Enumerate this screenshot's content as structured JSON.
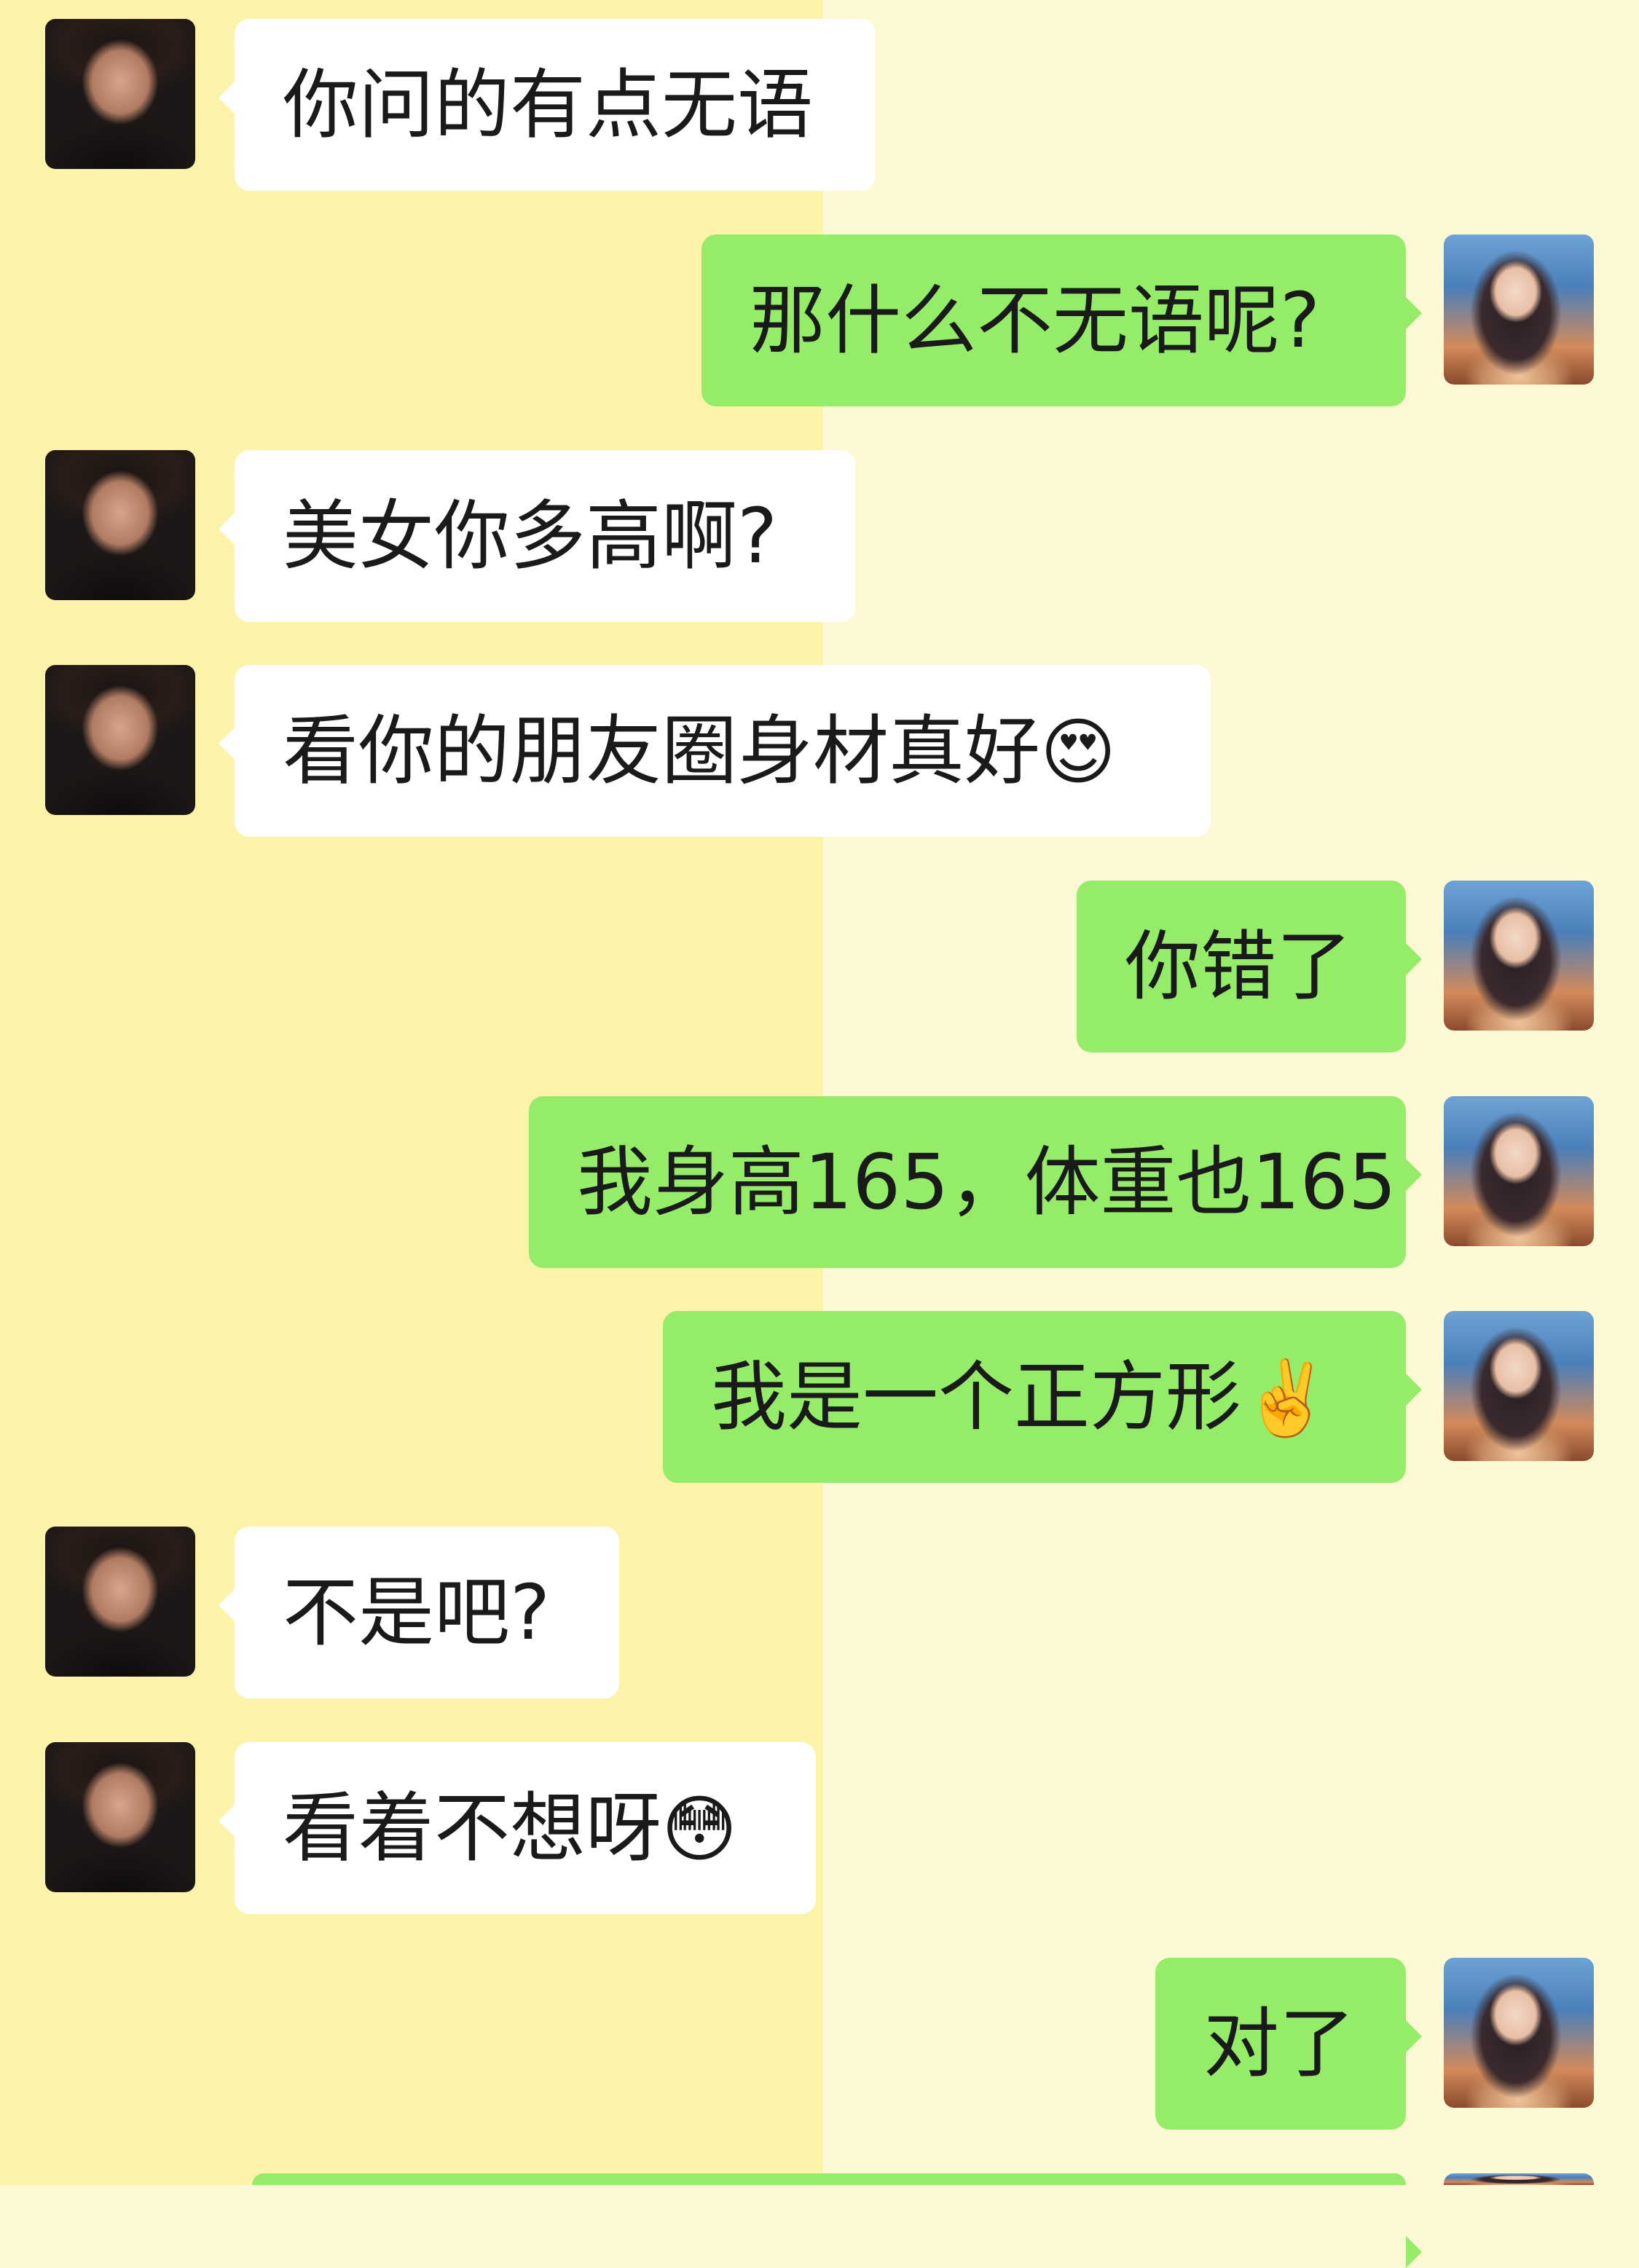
{
  "chat": {
    "messages": [
      {
        "sender": "other",
        "text": "你问的有点无语"
      },
      {
        "sender": "me",
        "text": "那什么不无语呢?"
      },
      {
        "sender": "other",
        "text": "美女你多高啊?"
      },
      {
        "sender": "other",
        "text": "看你的朋友圈身材真好",
        "emoji": "😍"
      },
      {
        "sender": "me",
        "text": "你错了"
      },
      {
        "sender": "me",
        "text": "我身高165，体重也165"
      },
      {
        "sender": "me",
        "text": "我是一个正方形",
        "emoji": "✌️"
      },
      {
        "sender": "other",
        "text": "不是吧?"
      },
      {
        "sender": "other",
        "text": "看着不想呀",
        "emoji": "😳"
      },
      {
        "sender": "me",
        "text": "对了"
      }
    ]
  },
  "colors": {
    "left_background": "#fbf3a8",
    "right_background": "#fdf9d4",
    "incoming_bubble": "#ffffff",
    "outgoing_bubble": "#95ec69"
  }
}
